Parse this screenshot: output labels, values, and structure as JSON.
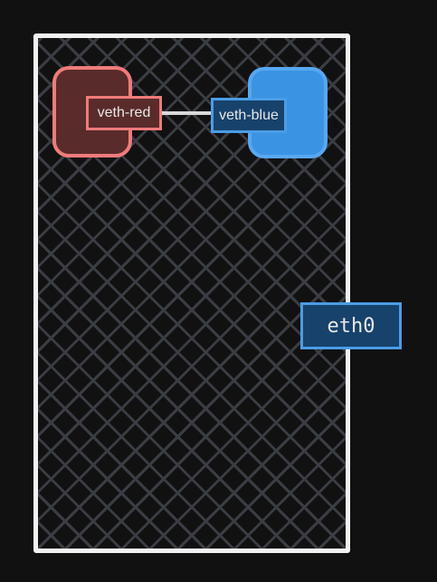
{
  "namespaces": {
    "red": {
      "color_fill": "#5a2b2b",
      "color_border": "#f07b7b",
      "interface_label": "veth-red"
    },
    "blue": {
      "color_fill": "#3b93e3",
      "color_border": "#57a8f0",
      "interface_label": "veth-blue"
    }
  },
  "host": {
    "border_color": "#f2f2f2",
    "background_pattern": "crosshatch",
    "interface_label": "eth0"
  },
  "link": {
    "color": "#d9d9d9"
  }
}
